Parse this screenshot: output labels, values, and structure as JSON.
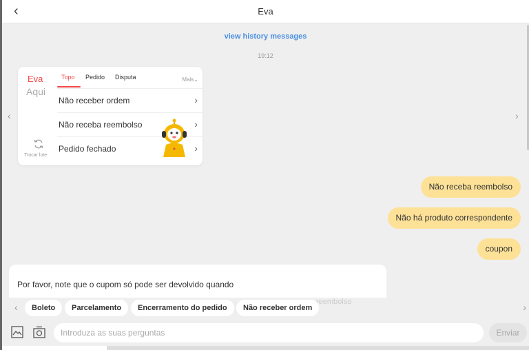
{
  "header": {
    "back_icon": "chevron-left-icon",
    "title": "Eva"
  },
  "chat": {
    "history_link": "view history messages",
    "timestamp": "19:12",
    "card": {
      "brand_line1": "Eva",
      "brand_line2": "Aqui",
      "refresh_label": "Trocar lote",
      "tabs": [
        {
          "label": "Topo",
          "active": true
        },
        {
          "label": "Pedido",
          "active": false
        },
        {
          "label": "Disputa",
          "active": false
        }
      ],
      "more_label": "Mais",
      "items": [
        {
          "label": "Não receber ordem"
        },
        {
          "label": "Não receba reembolso"
        },
        {
          "label": "Pedido fechado"
        }
      ]
    },
    "user_messages": [
      "Não receba reembolso",
      "Não há produto correspondente",
      "coupon"
    ],
    "bot_message": "Por favor, note que o cupom só pode ser devolvido quando"
  },
  "quick_replies": {
    "chips": [
      "Boleto",
      "Parcelamento",
      "Encerramento do pedido",
      "Não receber ordem"
    ],
    "overflow_text": "reembolso"
  },
  "input_bar": {
    "placeholder": "Introduza as suas perguntas",
    "send_label": "Enviar"
  },
  "colors": {
    "accent_red": "#f04848",
    "user_bubble": "#fde197",
    "link_blue": "#4a90e2"
  }
}
